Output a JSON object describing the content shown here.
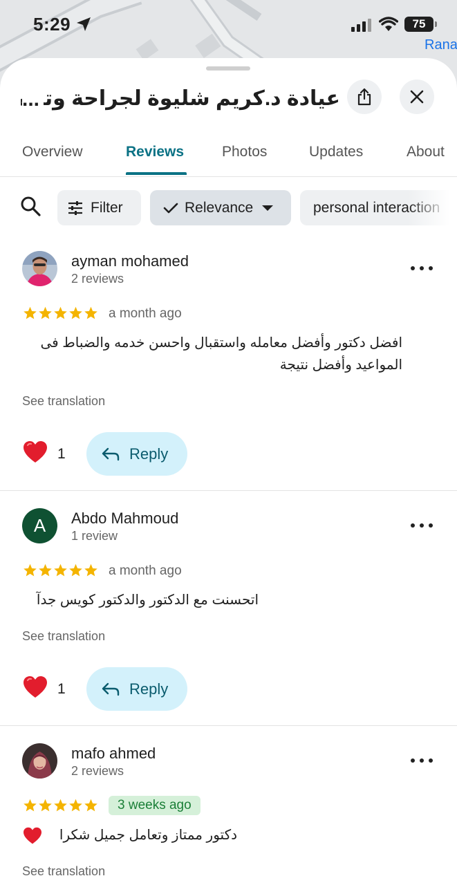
{
  "status_bar": {
    "time": "5:29",
    "battery": "75",
    "map_label": "Rana"
  },
  "place": {
    "title": "عيادة د.كريم شليوة لجراحة وتجميل الأنف",
    "ellipsis": "..."
  },
  "tabs": [
    {
      "label": "Overview",
      "active": false
    },
    {
      "label": "Reviews",
      "active": true
    },
    {
      "label": "Photos",
      "active": false
    },
    {
      "label": "Updates",
      "active": false
    },
    {
      "label": "About",
      "active": false
    }
  ],
  "filters": {
    "filter_label": "Filter",
    "sort_label": "Relevance",
    "topic_label": "personal interaction"
  },
  "reviews": [
    {
      "name": "ayman mohamed",
      "count": "2 reviews",
      "rating": 5,
      "date": "a month ago",
      "text": "افضل دكتور وأفضل معامله واستقبال واحسن خدمه والضباط فى المواعيد وأفضل نتيجة",
      "see_translation": "See translation",
      "likes": "1",
      "reply_label": "Reply"
    },
    {
      "name": "Abdo Mahmoud",
      "avatar_letter": "A",
      "count": "1 review",
      "rating": 5,
      "date": "a month ago",
      "text": "اتحسنت مع الدكتور والدكتور كويس جدآ",
      "see_translation": "See translation",
      "likes": "1",
      "reply_label": "Reply"
    },
    {
      "name": "mafo ahmed",
      "count": "2 reviews",
      "rating": 5,
      "date": "3 weeks ago",
      "text": "دكتور ممتاز وتعامل جميل شكرا",
      "see_translation": "See translation"
    }
  ],
  "colors": {
    "accent": "#0b7285",
    "star": "#f4b400",
    "reply_bg": "#d3f1fb",
    "new_badge_bg": "#d5f0d9"
  }
}
